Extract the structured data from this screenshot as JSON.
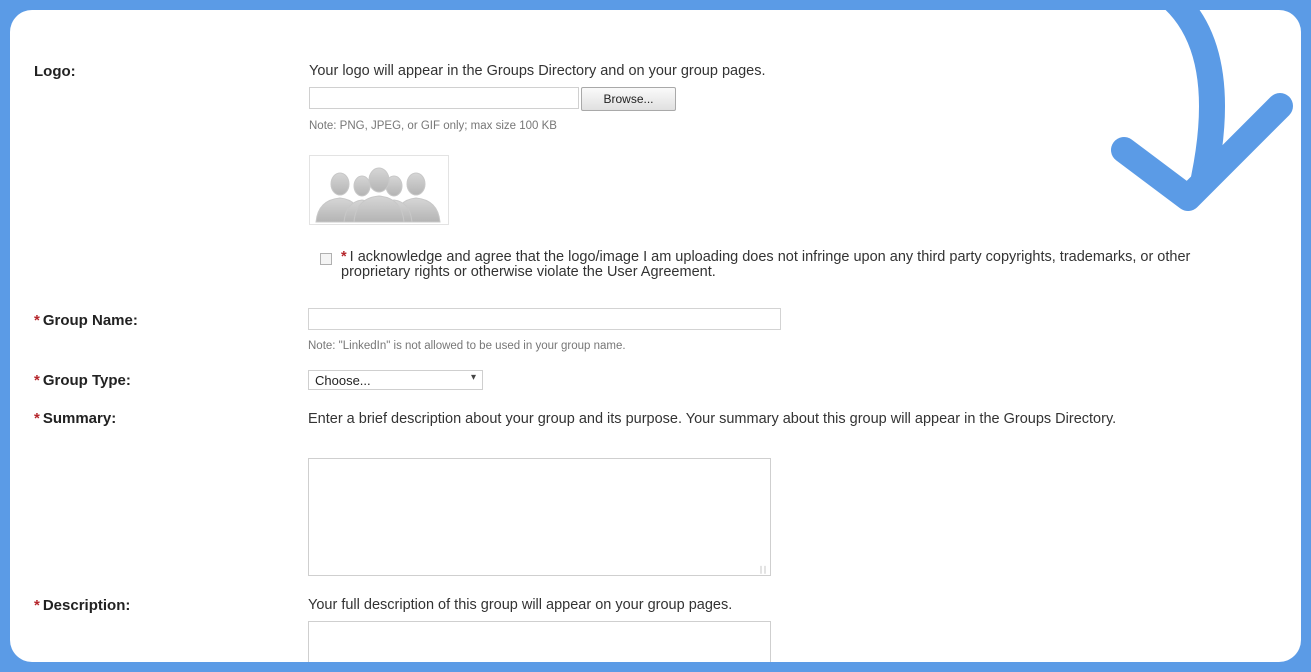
{
  "logo": {
    "label": "Logo:",
    "help": "Your logo will appear in the Groups Directory and on your group pages.",
    "browse_label": "Browse...",
    "note": "Note: PNG, JPEG, or GIF only; max size 100 KB"
  },
  "agreement": {
    "required_mark": "*",
    "text": "I acknowledge and agree that the logo/image I am uploading does not infringe upon any third party copyrights, trademarks, or other proprietary rights or otherwise violate the User Agreement."
  },
  "group_name": {
    "required_mark": "*",
    "label": "Group Name:",
    "value": "",
    "note": "Note: \"LinkedIn\" is not allowed to be used in your group name."
  },
  "group_type": {
    "required_mark": "*",
    "label": "Group Type:",
    "selected": "Choose..."
  },
  "summary": {
    "required_mark": "*",
    "label": "Summary:",
    "help": "Enter a brief description about your group and its purpose. Your summary about this group will appear in the Groups Directory."
  },
  "description": {
    "required_mark": "*",
    "label": "Description:",
    "help": "Your full description of this group will appear on your group pages."
  },
  "colors": {
    "frame": "#5b9be6",
    "required": "#b5262b",
    "arrow": "#5b9be6"
  },
  "icons": [
    "group-silhouette-icon",
    "scroll-down-arrow-icon",
    "select-caret-icon"
  ]
}
